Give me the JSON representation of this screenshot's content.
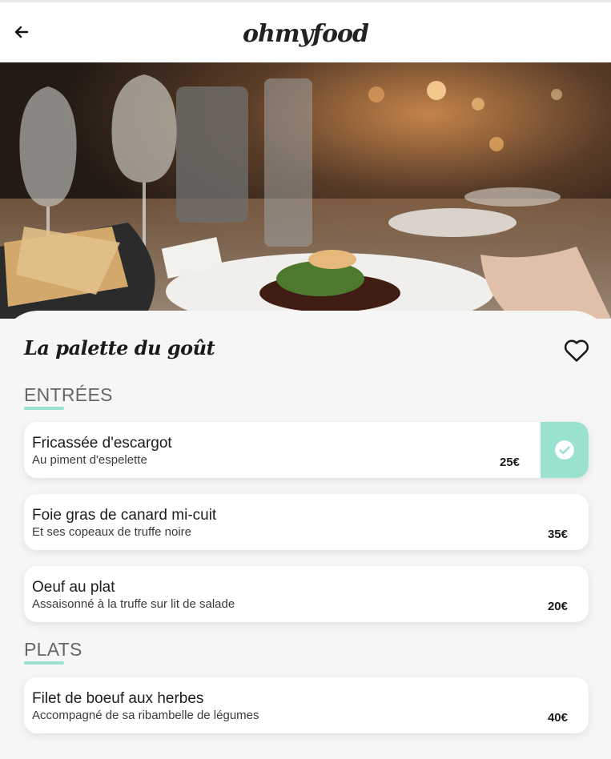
{
  "header": {
    "logo": "ohmyfood"
  },
  "restaurant": {
    "name": "La palette du goût"
  },
  "colors": {
    "accent": "#99e2d0",
    "text": "#1b1b1b",
    "section": "#666666"
  },
  "sections": [
    {
      "title": "ENTRÉES",
      "items": [
        {
          "name": "Fricassée d'escargot",
          "desc": "Au piment d'espelette",
          "price": "25€",
          "selected": true
        },
        {
          "name": "Foie gras de canard mi-cuit",
          "desc": "Et ses copeaux de truffe noire",
          "price": "35€",
          "selected": false
        },
        {
          "name": "Oeuf au plat",
          "desc": "Assaisonné à la truffe sur lit de salade",
          "price": "20€",
          "selected": false
        }
      ]
    },
    {
      "title": "PLATS",
      "items": [
        {
          "name": "Filet de boeuf aux herbes",
          "desc": "Accompagné de sa ribambelle de légumes",
          "price": "40€",
          "selected": false
        }
      ]
    }
  ],
  "icons": {
    "back": "arrow-left-icon",
    "favorite": "heart-outline-icon",
    "selected": "check-circle-icon"
  }
}
